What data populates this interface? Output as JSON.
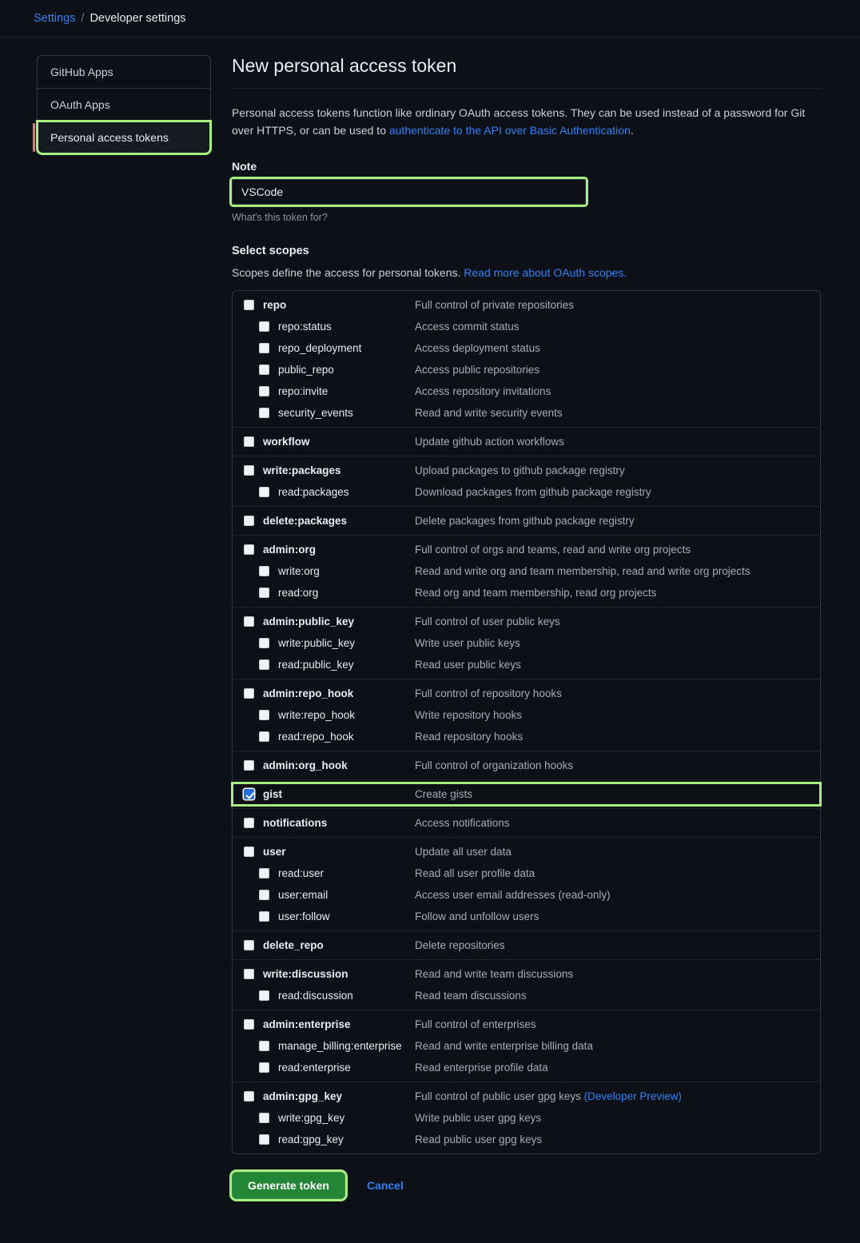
{
  "breadcrumb": {
    "settings_label": "Settings",
    "separator": "/",
    "current_label": "Developer settings"
  },
  "sidebar": {
    "items": [
      {
        "label": "GitHub Apps",
        "selected": false
      },
      {
        "label": "OAuth Apps",
        "selected": false
      },
      {
        "label": "Personal access tokens",
        "selected": true
      }
    ]
  },
  "main": {
    "title": "New personal access token",
    "intro_text_1": "Personal access tokens function like ordinary OAuth access tokens. They can be used instead of a password for Git over HTTPS, or can be used to ",
    "intro_link": "authenticate to the API over Basic Authentication",
    "intro_text_2": ".",
    "note_label": "Note",
    "note_value": "VSCode",
    "note_placeholder": "What's this token for?",
    "note_help": "What's this token for?",
    "scopes_title": "Select scopes",
    "scopes_sub_text": "Scopes define the access for personal tokens. ",
    "scopes_sub_link": "Read more about OAuth scopes.",
    "generate_label": "Generate token",
    "cancel_label": "Cancel"
  },
  "colors": {
    "page_background": "#0d1117",
    "highlight_ring": "#a6f07f",
    "link_blue": "#2f81f7",
    "checked_checkbox": "#1f6feb",
    "primary_button": "#238636",
    "active_nav_accent": "#f0776c"
  },
  "scope_groups": [
    {
      "rows": [
        {
          "name": "repo",
          "desc": "Full control of private repositories",
          "level": "parent",
          "checked": false
        },
        {
          "name": "repo:status",
          "desc": "Access commit status",
          "level": "child",
          "checked": false
        },
        {
          "name": "repo_deployment",
          "desc": "Access deployment status",
          "level": "child",
          "checked": false
        },
        {
          "name": "public_repo",
          "desc": "Access public repositories",
          "level": "child",
          "checked": false
        },
        {
          "name": "repo:invite",
          "desc": "Access repository invitations",
          "level": "child",
          "checked": false
        },
        {
          "name": "security_events",
          "desc": "Read and write security events",
          "level": "child",
          "checked": false
        }
      ]
    },
    {
      "rows": [
        {
          "name": "workflow",
          "desc": "Update github action workflows",
          "level": "parent",
          "checked": false
        }
      ]
    },
    {
      "rows": [
        {
          "name": "write:packages",
          "desc": "Upload packages to github package registry",
          "level": "parent",
          "checked": false
        },
        {
          "name": "read:packages",
          "desc": "Download packages from github package registry",
          "level": "child",
          "checked": false
        }
      ]
    },
    {
      "rows": [
        {
          "name": "delete:packages",
          "desc": "Delete packages from github package registry",
          "level": "parent",
          "checked": false
        }
      ]
    },
    {
      "rows": [
        {
          "name": "admin:org",
          "desc": "Full control of orgs and teams, read and write org projects",
          "level": "parent",
          "checked": false
        },
        {
          "name": "write:org",
          "desc": "Read and write org and team membership, read and write org projects",
          "level": "child",
          "checked": false
        },
        {
          "name": "read:org",
          "desc": "Read org and team membership, read org projects",
          "level": "child",
          "checked": false
        }
      ]
    },
    {
      "rows": [
        {
          "name": "admin:public_key",
          "desc": "Full control of user public keys",
          "level": "parent",
          "checked": false
        },
        {
          "name": "write:public_key",
          "desc": "Write user public keys",
          "level": "child",
          "checked": false
        },
        {
          "name": "read:public_key",
          "desc": "Read user public keys",
          "level": "child",
          "checked": false
        }
      ]
    },
    {
      "rows": [
        {
          "name": "admin:repo_hook",
          "desc": "Full control of repository hooks",
          "level": "parent",
          "checked": false
        },
        {
          "name": "write:repo_hook",
          "desc": "Write repository hooks",
          "level": "child",
          "checked": false
        },
        {
          "name": "read:repo_hook",
          "desc": "Read repository hooks",
          "level": "child",
          "checked": false
        }
      ]
    },
    {
      "rows": [
        {
          "name": "admin:org_hook",
          "desc": "Full control of organization hooks",
          "level": "parent",
          "checked": false
        }
      ]
    },
    {
      "rows": [
        {
          "name": "gist",
          "desc": "Create gists",
          "level": "parent",
          "checked": true,
          "highlighted": true
        }
      ]
    },
    {
      "rows": [
        {
          "name": "notifications",
          "desc": "Access notifications",
          "level": "parent",
          "checked": false
        }
      ]
    },
    {
      "rows": [
        {
          "name": "user",
          "desc": "Update all user data",
          "level": "parent",
          "checked": false
        },
        {
          "name": "read:user",
          "desc": "Read all user profile data",
          "level": "child",
          "checked": false
        },
        {
          "name": "user:email",
          "desc": "Access user email addresses (read-only)",
          "level": "child",
          "checked": false
        },
        {
          "name": "user:follow",
          "desc": "Follow and unfollow users",
          "level": "child",
          "checked": false
        }
      ]
    },
    {
      "rows": [
        {
          "name": "delete_repo",
          "desc": "Delete repositories",
          "level": "parent",
          "checked": false
        }
      ]
    },
    {
      "rows": [
        {
          "name": "write:discussion",
          "desc": "Read and write team discussions",
          "level": "parent",
          "checked": false
        },
        {
          "name": "read:discussion",
          "desc": "Read team discussions",
          "level": "child",
          "checked": false
        }
      ]
    },
    {
      "rows": [
        {
          "name": "admin:enterprise",
          "desc": "Full control of enterprises",
          "level": "parent",
          "checked": false
        },
        {
          "name": "manage_billing:enterprise",
          "desc": "Read and write enterprise billing data",
          "level": "child",
          "checked": false
        },
        {
          "name": "read:enterprise",
          "desc": "Read enterprise profile data",
          "level": "child",
          "checked": false
        }
      ]
    },
    {
      "rows": [
        {
          "name": "admin:gpg_key",
          "desc": "Full control of public user gpg keys ",
          "desc_link": "(Developer Preview)",
          "level": "parent",
          "checked": false
        },
        {
          "name": "write:gpg_key",
          "desc": "Write public user gpg keys",
          "level": "child",
          "checked": false
        },
        {
          "name": "read:gpg_key",
          "desc": "Read public user gpg keys",
          "level": "child",
          "checked": false
        }
      ]
    }
  ]
}
